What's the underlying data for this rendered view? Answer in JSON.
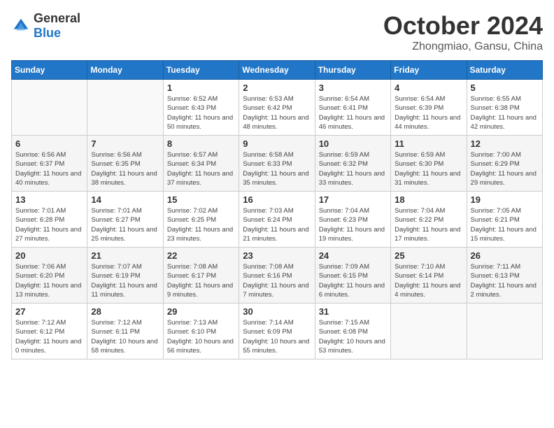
{
  "logo": {
    "general": "General",
    "blue": "Blue"
  },
  "title": "October 2024",
  "location": "Zhongmiao, Gansu, China",
  "weekdays": [
    "Sunday",
    "Monday",
    "Tuesday",
    "Wednesday",
    "Thursday",
    "Friday",
    "Saturday"
  ],
  "weeks": [
    [
      {
        "day": "",
        "info": ""
      },
      {
        "day": "",
        "info": ""
      },
      {
        "day": "1",
        "info": "Sunrise: 6:52 AM\nSunset: 6:43 PM\nDaylight: 11 hours and 50 minutes."
      },
      {
        "day": "2",
        "info": "Sunrise: 6:53 AM\nSunset: 6:42 PM\nDaylight: 11 hours and 48 minutes."
      },
      {
        "day": "3",
        "info": "Sunrise: 6:54 AM\nSunset: 6:41 PM\nDaylight: 11 hours and 46 minutes."
      },
      {
        "day": "4",
        "info": "Sunrise: 6:54 AM\nSunset: 6:39 PM\nDaylight: 11 hours and 44 minutes."
      },
      {
        "day": "5",
        "info": "Sunrise: 6:55 AM\nSunset: 6:38 PM\nDaylight: 11 hours and 42 minutes."
      }
    ],
    [
      {
        "day": "6",
        "info": "Sunrise: 6:56 AM\nSunset: 6:37 PM\nDaylight: 11 hours and 40 minutes."
      },
      {
        "day": "7",
        "info": "Sunrise: 6:56 AM\nSunset: 6:35 PM\nDaylight: 11 hours and 38 minutes."
      },
      {
        "day": "8",
        "info": "Sunrise: 6:57 AM\nSunset: 6:34 PM\nDaylight: 11 hours and 37 minutes."
      },
      {
        "day": "9",
        "info": "Sunrise: 6:58 AM\nSunset: 6:33 PM\nDaylight: 11 hours and 35 minutes."
      },
      {
        "day": "10",
        "info": "Sunrise: 6:59 AM\nSunset: 6:32 PM\nDaylight: 11 hours and 33 minutes."
      },
      {
        "day": "11",
        "info": "Sunrise: 6:59 AM\nSunset: 6:30 PM\nDaylight: 11 hours and 31 minutes."
      },
      {
        "day": "12",
        "info": "Sunrise: 7:00 AM\nSunset: 6:29 PM\nDaylight: 11 hours and 29 minutes."
      }
    ],
    [
      {
        "day": "13",
        "info": "Sunrise: 7:01 AM\nSunset: 6:28 PM\nDaylight: 11 hours and 27 minutes."
      },
      {
        "day": "14",
        "info": "Sunrise: 7:01 AM\nSunset: 6:27 PM\nDaylight: 11 hours and 25 minutes."
      },
      {
        "day": "15",
        "info": "Sunrise: 7:02 AM\nSunset: 6:25 PM\nDaylight: 11 hours and 23 minutes."
      },
      {
        "day": "16",
        "info": "Sunrise: 7:03 AM\nSunset: 6:24 PM\nDaylight: 11 hours and 21 minutes."
      },
      {
        "day": "17",
        "info": "Sunrise: 7:04 AM\nSunset: 6:23 PM\nDaylight: 11 hours and 19 minutes."
      },
      {
        "day": "18",
        "info": "Sunrise: 7:04 AM\nSunset: 6:22 PM\nDaylight: 11 hours and 17 minutes."
      },
      {
        "day": "19",
        "info": "Sunrise: 7:05 AM\nSunset: 6:21 PM\nDaylight: 11 hours and 15 minutes."
      }
    ],
    [
      {
        "day": "20",
        "info": "Sunrise: 7:06 AM\nSunset: 6:20 PM\nDaylight: 11 hours and 13 minutes."
      },
      {
        "day": "21",
        "info": "Sunrise: 7:07 AM\nSunset: 6:19 PM\nDaylight: 11 hours and 11 minutes."
      },
      {
        "day": "22",
        "info": "Sunrise: 7:08 AM\nSunset: 6:17 PM\nDaylight: 11 hours and 9 minutes."
      },
      {
        "day": "23",
        "info": "Sunrise: 7:08 AM\nSunset: 6:16 PM\nDaylight: 11 hours and 7 minutes."
      },
      {
        "day": "24",
        "info": "Sunrise: 7:09 AM\nSunset: 6:15 PM\nDaylight: 11 hours and 6 minutes."
      },
      {
        "day": "25",
        "info": "Sunrise: 7:10 AM\nSunset: 6:14 PM\nDaylight: 11 hours and 4 minutes."
      },
      {
        "day": "26",
        "info": "Sunrise: 7:11 AM\nSunset: 6:13 PM\nDaylight: 11 hours and 2 minutes."
      }
    ],
    [
      {
        "day": "27",
        "info": "Sunrise: 7:12 AM\nSunset: 6:12 PM\nDaylight: 11 hours and 0 minutes."
      },
      {
        "day": "28",
        "info": "Sunrise: 7:12 AM\nSunset: 6:11 PM\nDaylight: 10 hours and 58 minutes."
      },
      {
        "day": "29",
        "info": "Sunrise: 7:13 AM\nSunset: 6:10 PM\nDaylight: 10 hours and 56 minutes."
      },
      {
        "day": "30",
        "info": "Sunrise: 7:14 AM\nSunset: 6:09 PM\nDaylight: 10 hours and 55 minutes."
      },
      {
        "day": "31",
        "info": "Sunrise: 7:15 AM\nSunset: 6:08 PM\nDaylight: 10 hours and 53 minutes."
      },
      {
        "day": "",
        "info": ""
      },
      {
        "day": "",
        "info": ""
      }
    ]
  ]
}
